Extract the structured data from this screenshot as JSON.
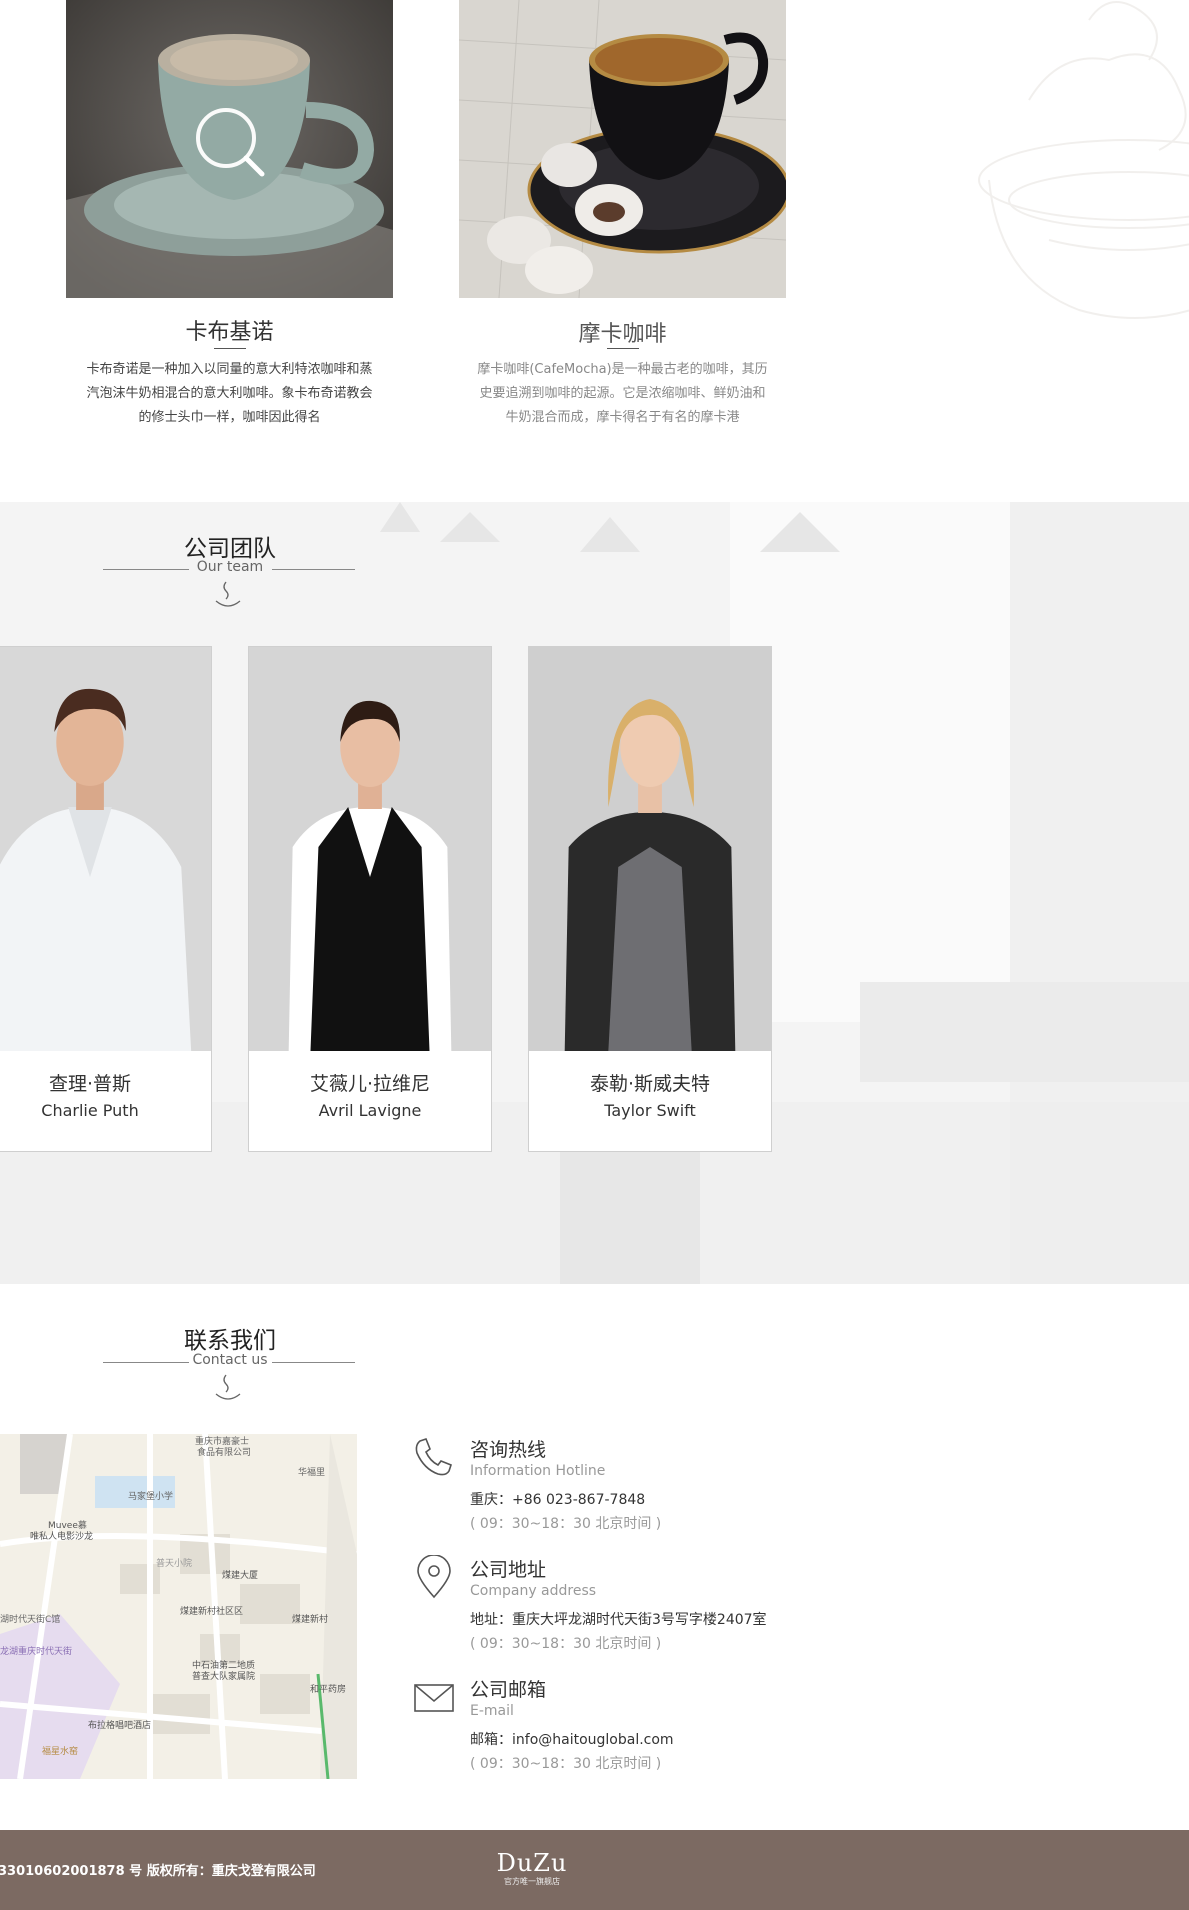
{
  "products": [
    {
      "name": "卡布基诺",
      "desc_lines": [
        "卡布奇诺是一种加入以同量的意大利特浓咖啡和蒸",
        "汽泡沫牛奶相混合的意大利咖啡。象卡布奇诺教会",
        "的修士头巾一样，咖啡因此得名"
      ]
    },
    {
      "name": "摩卡咖啡",
      "desc_lines": [
        "摩卡咖啡(CafeMocha)是一种最古老的咖啡，其历",
        "史要追溯到咖啡的起源。它是浓缩咖啡、鲜奶油和",
        "牛奶混合而成，摩卡得名于有名的摩卡港"
      ]
    }
  ],
  "team": {
    "title": "公司团队",
    "subtitle": "Our team",
    "members": [
      {
        "name_cn": "查理·普斯",
        "name_en": "Charlie Puth"
      },
      {
        "name_cn": "艾薇儿·拉维尼",
        "name_en": "Avril Lavigne"
      },
      {
        "name_cn": "泰勒·斯威夫特",
        "name_en": "Taylor Swift"
      }
    ]
  },
  "contact": {
    "title": "联系我们",
    "subtitle": "Contact us",
    "map_labels": [
      "重庆市嘉豪士",
      "食品有限公司",
      "马家堡小学",
      "Muvee慕",
      "唯私人电影沙龙",
      "普天小院",
      "煤建大厦",
      "煤建新村社区区",
      "煤建新村",
      "湖时代天街C馆",
      "龙湖重庆时代天街",
      "中石油第二地质",
      "普查大队家属院",
      "布拉格唱吧酒店",
      "福星水窑",
      "和平药房",
      "华福里"
    ],
    "hotline": {
      "title": "咨询热线",
      "subtitle": "Information Hotline",
      "line": "重庆：+86 023-867-7848",
      "hours": "( 09：30~18：30 北京时间 )"
    },
    "address": {
      "title": "公司地址",
      "subtitle": "Company address",
      "line": "地址：重庆大坪龙湖时代天街3号写字楼2407室",
      "hours": "( 09：30~18：30 北京时间 )"
    },
    "email": {
      "title": "公司邮箱",
      "subtitle": "E-mail",
      "line": "邮箱：info@haitouglobal.com",
      "hours": "( 09：30~18：30 北京时间 )"
    }
  },
  "footer": {
    "copyright": "33010602001878 号  版权所有：重庆戈登有限公司",
    "logo": "DuZu",
    "logo_sub": "官方唯一旗舰店"
  }
}
